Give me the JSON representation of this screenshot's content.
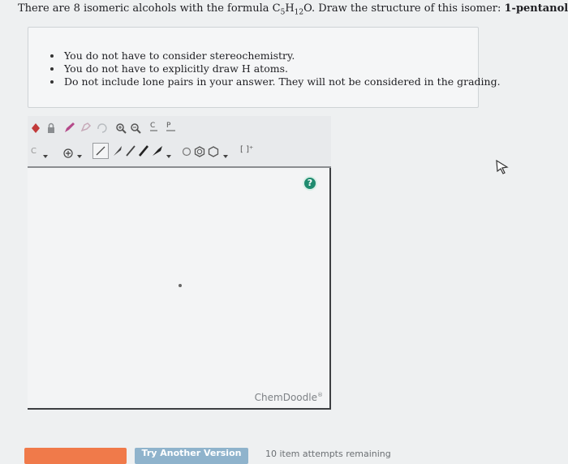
{
  "question": {
    "pre": "There are 8 isomeric alcohols with the formula C",
    "sub1": "5",
    "mid": "H",
    "sub2": "12",
    "post": "O. Draw the structure of this isomer: ",
    "isomer": "1-pentanol."
  },
  "instructions": [
    "You do not have to consider stereochemistry.",
    "You do not have to explicitly draw H atoms.",
    "Do not include lone pairs in your answer. They will not be considered in the grading."
  ],
  "editor": {
    "brand": "ChemDoodle",
    "brand_mark": "®",
    "help_label": "?",
    "element_label": "C",
    "bracket_label": "[ ]⁺"
  },
  "footer": {
    "submit_label": "",
    "try_another_label": "Try Another Version",
    "attempts_text": "10 item attempts remaining"
  },
  "colors": {
    "submit": "#f07a4a",
    "try_another": "#8fb3cc",
    "help": "#1f8b6f"
  }
}
